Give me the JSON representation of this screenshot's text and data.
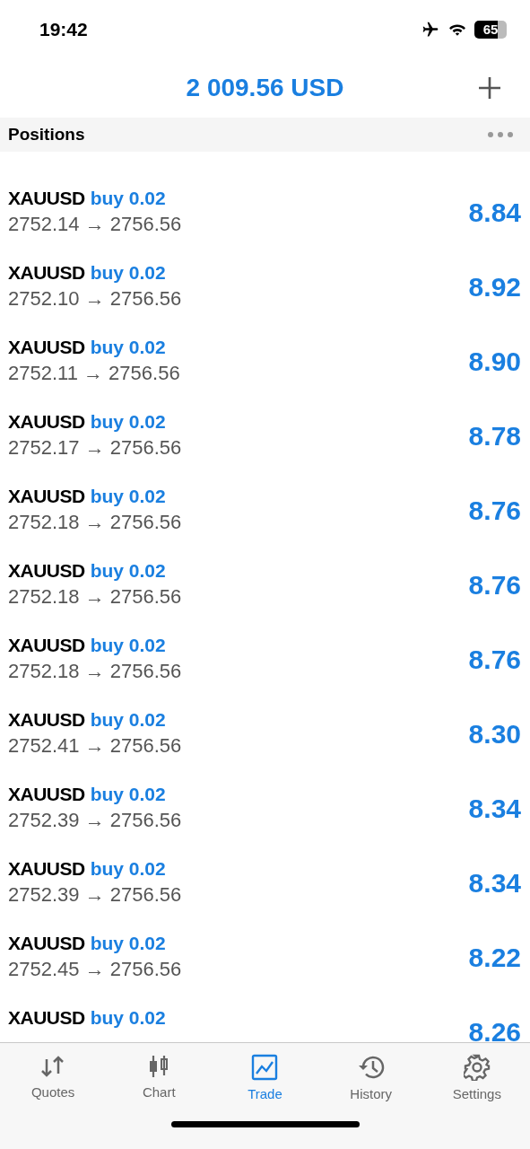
{
  "status_bar": {
    "time": "19:42",
    "battery": "65"
  },
  "header": {
    "balance": "2 009.56 USD"
  },
  "section": {
    "title": "Positions"
  },
  "positions": [
    {
      "symbol": "XAUUSD",
      "order": "buy 0.02",
      "prices": "2752.14 → 2756.56",
      "profit": "8.84"
    },
    {
      "symbol": "XAUUSD",
      "order": "buy 0.02",
      "prices": "2752.10 → 2756.56",
      "profit": "8.92"
    },
    {
      "symbol": "XAUUSD",
      "order": "buy 0.02",
      "prices": "2752.11 → 2756.56",
      "profit": "8.90"
    },
    {
      "symbol": "XAUUSD",
      "order": "buy 0.02",
      "prices": "2752.17 → 2756.56",
      "profit": "8.78"
    },
    {
      "symbol": "XAUUSD",
      "order": "buy 0.02",
      "prices": "2752.18 → 2756.56",
      "profit": "8.76"
    },
    {
      "symbol": "XAUUSD",
      "order": "buy 0.02",
      "prices": "2752.18 → 2756.56",
      "profit": "8.76"
    },
    {
      "symbol": "XAUUSD",
      "order": "buy 0.02",
      "prices": "2752.18 → 2756.56",
      "profit": "8.76"
    },
    {
      "symbol": "XAUUSD",
      "order": "buy 0.02",
      "prices": "2752.41 → 2756.56",
      "profit": "8.30"
    },
    {
      "symbol": "XAUUSD",
      "order": "buy 0.02",
      "prices": "2752.39 → 2756.56",
      "profit": "8.34"
    },
    {
      "symbol": "XAUUSD",
      "order": "buy 0.02",
      "prices": "2752.39 → 2756.56",
      "profit": "8.34"
    },
    {
      "symbol": "XAUUSD",
      "order": "buy 0.02",
      "prices": "2752.45 → 2756.56",
      "profit": "8.22"
    },
    {
      "symbol": "XAUUSD",
      "order": "buy 0.02",
      "profit": "8.26"
    }
  ],
  "tabs": [
    {
      "kind": "quotes",
      "label": "Quotes",
      "selected": false
    },
    {
      "kind": "chart",
      "label": "Chart",
      "selected": false
    },
    {
      "kind": "trade",
      "label": "Trade",
      "selected": true
    },
    {
      "kind": "history",
      "label": "History",
      "selected": false
    },
    {
      "kind": "settings",
      "label": "Settings",
      "selected": false
    }
  ]
}
